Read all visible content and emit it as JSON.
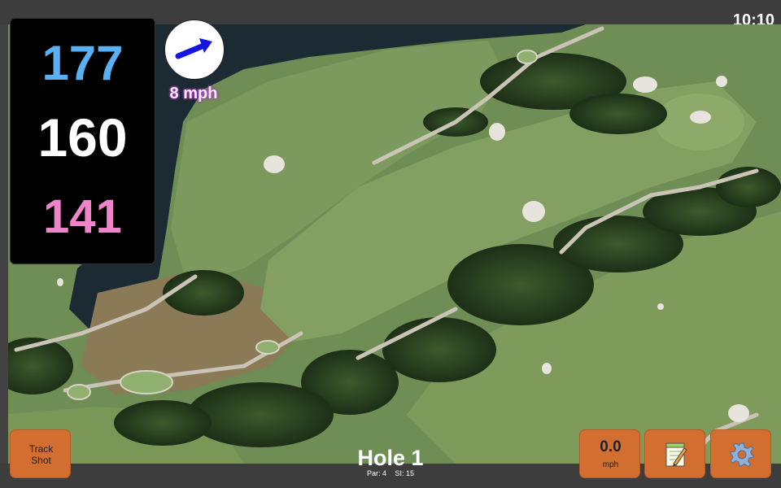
{
  "status_bar": {
    "time": "10:10"
  },
  "distances": {
    "back": "177",
    "middle": "160",
    "front": "141"
  },
  "wind": {
    "speed": "8 mph",
    "icon": "wind-direction-arrow-icon"
  },
  "buttons": {
    "track_shot": "Track\nShot",
    "speed_value": "0.0",
    "speed_unit": "mph",
    "notes_icon": "notepad-icon",
    "settings_icon": "gear-icon"
  },
  "hole": {
    "title": "Hole 1",
    "par": "Par: 4",
    "si": "SI: 15"
  },
  "colors": {
    "back_distance": "#5ab0f5",
    "middle_distance": "#ffffff",
    "front_distance": "#f084c8",
    "button": "#d26e2f",
    "wind_text_glow": "#a23fb8"
  }
}
